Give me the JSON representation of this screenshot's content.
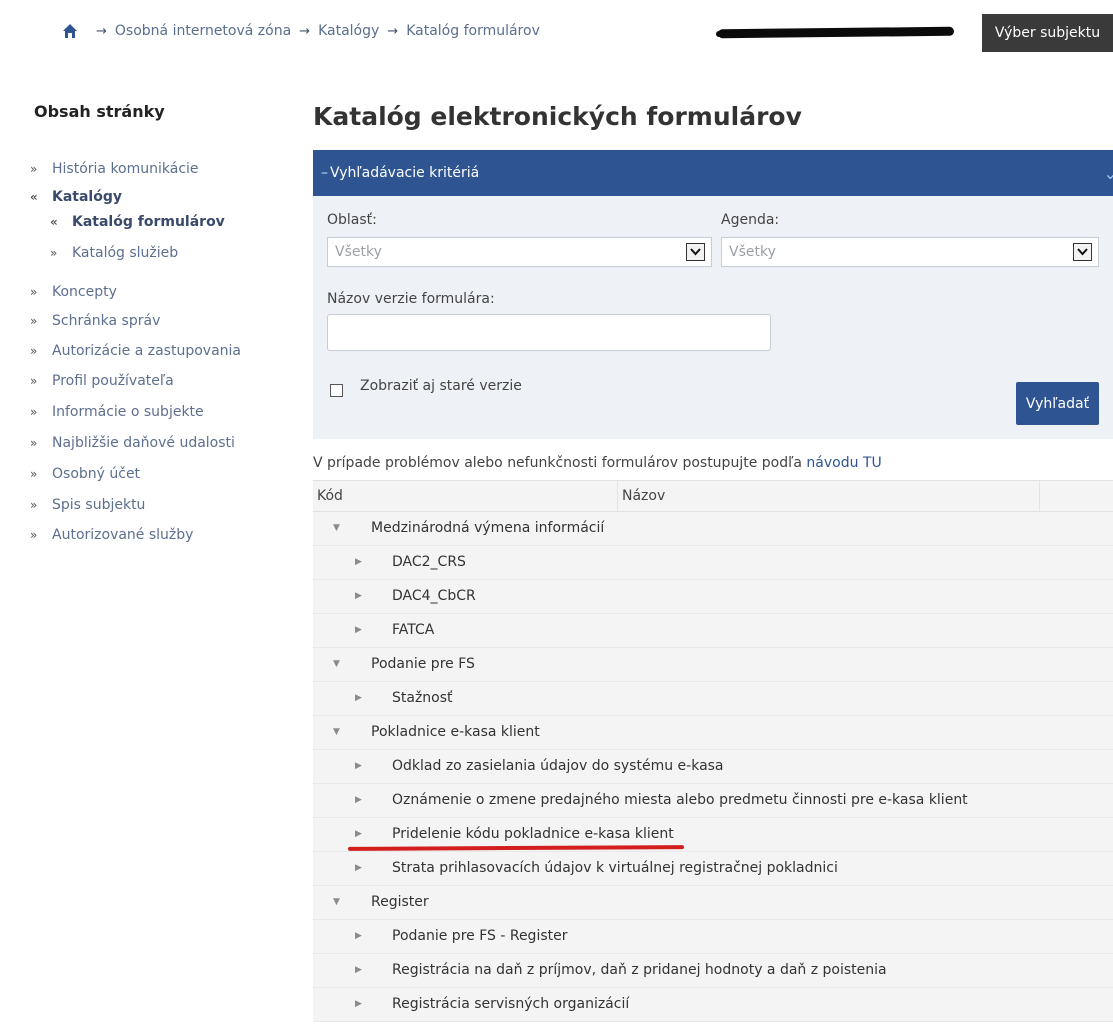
{
  "breadcrumb": {
    "items": [
      "Osobná internetová zóna",
      "Katalógy",
      "Katalóg formulárov"
    ],
    "separator": "→"
  },
  "header": {
    "subject_button": "Výber subjektu"
  },
  "sidebar": {
    "title": "Obsah stránky",
    "items": [
      {
        "label": "História komunikácie"
      },
      {
        "label": "Katalógy"
      },
      {
        "label": "Katalóg formulárov"
      },
      {
        "label": "Katalóg služieb"
      },
      {
        "label": "Koncepty"
      },
      {
        "label": "Schránka správ"
      },
      {
        "label": "Autorizácie a zastupovania"
      },
      {
        "label": "Profil používateľa"
      },
      {
        "label": "Informácie o subjekte"
      },
      {
        "label": "Najbližšie daňové udalosti"
      },
      {
        "label": "Osobný účet"
      },
      {
        "label": "Spis subjektu"
      },
      {
        "label": "Autorizované služby"
      }
    ]
  },
  "main": {
    "title": "Katalóg elektronických formulárov",
    "criteria": {
      "header": "Vyhľadávacie kritériá",
      "area_label": "Oblasť:",
      "area_value": "Všetky",
      "agenda_label": "Agenda:",
      "agenda_value": "Všetky",
      "name_label": "Názov verzie formulára:",
      "name_value": "",
      "old_versions_label": "Zobraziť aj staré verzie",
      "search_button": "Vyhľadať"
    },
    "help_text": "V prípade problémov alebo nefunkčnosti formulárov postupujte podľa",
    "help_link": "návodu TU",
    "table": {
      "columns": [
        "Kód",
        "Názov"
      ],
      "rows": [
        {
          "level": 0,
          "label": "Medzinárodná výmena informácií"
        },
        {
          "level": 1,
          "label": "DAC2_CRS"
        },
        {
          "level": 1,
          "label": "DAC4_CbCR"
        },
        {
          "level": 1,
          "label": "FATCA"
        },
        {
          "level": 0,
          "label": "Podanie pre FS"
        },
        {
          "level": 1,
          "label": "Stažnosť"
        },
        {
          "level": 0,
          "label": "Pokladnice e-kasa klient"
        },
        {
          "level": 1,
          "label": "Odklad zo zasielania údajov do systému e-kasa"
        },
        {
          "level": 1,
          "label": "Oznámenie o zmene predajného miesta alebo predmetu činnosti pre e-kasa klient"
        },
        {
          "level": 1,
          "label": "Pridelenie kódu pokladnice e-kasa klient"
        },
        {
          "level": 1,
          "label": "Strata prihlasovacích údajov k virtuálnej registračnej pokladnici"
        },
        {
          "level": 0,
          "label": "Register"
        },
        {
          "level": 1,
          "label": "Podanie pre FS - Register"
        },
        {
          "level": 1,
          "label": "Registrácia na daň z príjmov, daň z pridanej hodnoty a daň z poistenia"
        },
        {
          "level": 1,
          "label": "Registrácia servisných organizácií"
        }
      ]
    }
  },
  "icons": {
    "home": "home-icon",
    "expand": "triangle-down-icon",
    "collapse": "triangle-right-icon"
  },
  "colors": {
    "brand": "#2f5492",
    "annotation": "#d41e1e"
  }
}
